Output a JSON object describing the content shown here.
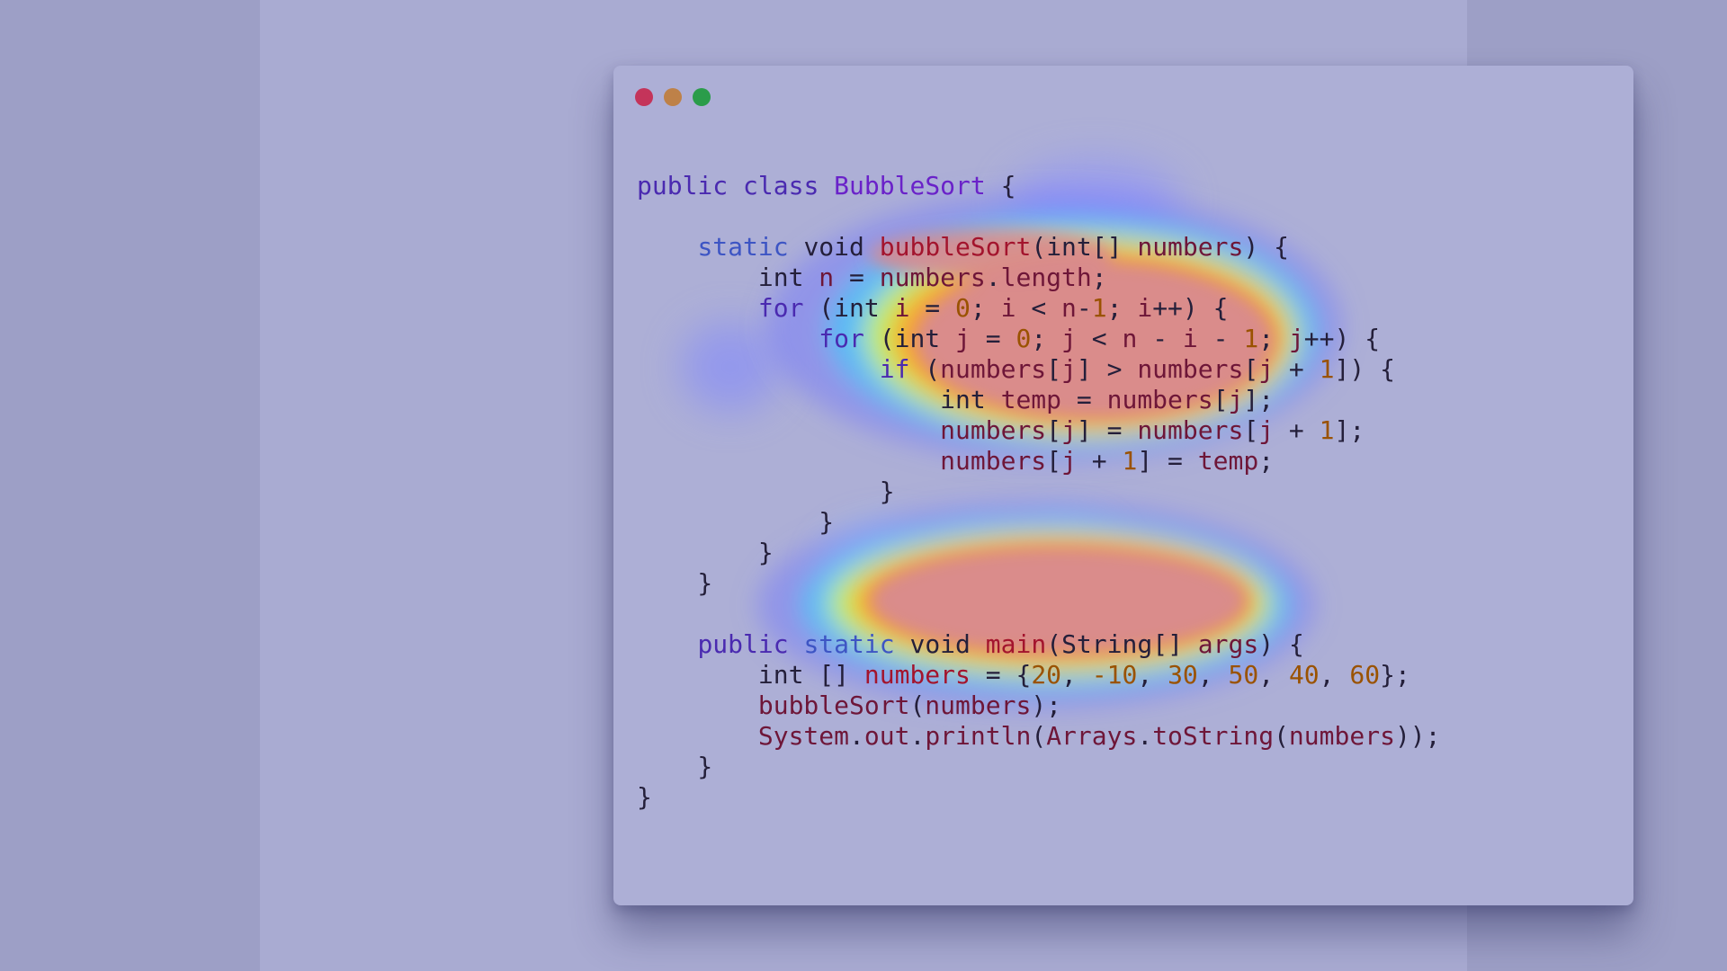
{
  "window_controls": {
    "close": {
      "color": "#c4345a"
    },
    "minimize": {
      "color": "#be8148"
    },
    "maximize": {
      "color": "#2a9c4a"
    }
  },
  "colors": {
    "outer_background": "#9d9fc6",
    "stage_background": "#a9abd2",
    "window_background": "#adafd6"
  },
  "overlay": {
    "type": "attention-heatmap",
    "palette": [
      "blue",
      "cyan",
      "yellow",
      "red"
    ]
  },
  "code": {
    "language": "java",
    "lines": [
      [
        {
          "t": "public ",
          "c": "kw"
        },
        {
          "t": "class ",
          "c": "kw"
        },
        {
          "t": "BubbleSort",
          "c": "cls"
        },
        {
          "t": " {",
          "c": "pl"
        }
      ],
      [],
      [
        {
          "t": "    ",
          "c": "pl"
        },
        {
          "t": "static ",
          "c": "kw2"
        },
        {
          "t": "void ",
          "c": "pl"
        },
        {
          "t": "bubbleSort",
          "c": "fn"
        },
        {
          "t": "(",
          "c": "pl"
        },
        {
          "t": "int",
          "c": "pl"
        },
        {
          "t": "[] ",
          "c": "pl"
        },
        {
          "t": "numbers",
          "c": "id"
        },
        {
          "t": ") {",
          "c": "pl"
        }
      ],
      [
        {
          "t": "        ",
          "c": "pl"
        },
        {
          "t": "int ",
          "c": "pl"
        },
        {
          "t": "n",
          "c": "id"
        },
        {
          "t": " = ",
          "c": "pl"
        },
        {
          "t": "numbers",
          "c": "id"
        },
        {
          "t": ".",
          "c": "pl"
        },
        {
          "t": "length",
          "c": "id"
        },
        {
          "t": ";",
          "c": "pl"
        }
      ],
      [
        {
          "t": "        ",
          "c": "pl"
        },
        {
          "t": "for",
          "c": "kw"
        },
        {
          "t": " (",
          "c": "pl"
        },
        {
          "t": "int ",
          "c": "pl"
        },
        {
          "t": "i",
          "c": "id"
        },
        {
          "t": " = ",
          "c": "pl"
        },
        {
          "t": "0",
          "c": "num"
        },
        {
          "t": "; ",
          "c": "pl"
        },
        {
          "t": "i",
          "c": "id"
        },
        {
          "t": " < ",
          "c": "pl"
        },
        {
          "t": "n",
          "c": "id"
        },
        {
          "t": "-",
          "c": "pl"
        },
        {
          "t": "1",
          "c": "num"
        },
        {
          "t": "; ",
          "c": "pl"
        },
        {
          "t": "i",
          "c": "id"
        },
        {
          "t": "++) {",
          "c": "pl"
        }
      ],
      [
        {
          "t": "            ",
          "c": "pl"
        },
        {
          "t": "for",
          "c": "kw"
        },
        {
          "t": " (",
          "c": "pl"
        },
        {
          "t": "int ",
          "c": "pl"
        },
        {
          "t": "j",
          "c": "id"
        },
        {
          "t": " = ",
          "c": "pl"
        },
        {
          "t": "0",
          "c": "num"
        },
        {
          "t": "; ",
          "c": "pl"
        },
        {
          "t": "j",
          "c": "id"
        },
        {
          "t": " < ",
          "c": "pl"
        },
        {
          "t": "n",
          "c": "id"
        },
        {
          "t": " - ",
          "c": "pl"
        },
        {
          "t": "i",
          "c": "id"
        },
        {
          "t": " - ",
          "c": "pl"
        },
        {
          "t": "1",
          "c": "num"
        },
        {
          "t": "; ",
          "c": "pl"
        },
        {
          "t": "j",
          "c": "id"
        },
        {
          "t": "++) {",
          "c": "pl"
        }
      ],
      [
        {
          "t": "                ",
          "c": "pl"
        },
        {
          "t": "if",
          "c": "kw"
        },
        {
          "t": " (",
          "c": "pl"
        },
        {
          "t": "numbers",
          "c": "id"
        },
        {
          "t": "[",
          "c": "pl"
        },
        {
          "t": "j",
          "c": "id"
        },
        {
          "t": "] > ",
          "c": "pl"
        },
        {
          "t": "numbers",
          "c": "id"
        },
        {
          "t": "[",
          "c": "pl"
        },
        {
          "t": "j",
          "c": "id"
        },
        {
          "t": " + ",
          "c": "pl"
        },
        {
          "t": "1",
          "c": "num"
        },
        {
          "t": "]) {",
          "c": "pl"
        }
      ],
      [
        {
          "t": "                    ",
          "c": "pl"
        },
        {
          "t": "int ",
          "c": "pl"
        },
        {
          "t": "temp",
          "c": "id"
        },
        {
          "t": " = ",
          "c": "pl"
        },
        {
          "t": "numbers",
          "c": "id"
        },
        {
          "t": "[",
          "c": "pl"
        },
        {
          "t": "j",
          "c": "id"
        },
        {
          "t": "];",
          "c": "pl"
        }
      ],
      [
        {
          "t": "                    ",
          "c": "pl"
        },
        {
          "t": "numbers",
          "c": "id"
        },
        {
          "t": "[",
          "c": "pl"
        },
        {
          "t": "j",
          "c": "id"
        },
        {
          "t": "] = ",
          "c": "pl"
        },
        {
          "t": "numbers",
          "c": "id"
        },
        {
          "t": "[",
          "c": "pl"
        },
        {
          "t": "j",
          "c": "id"
        },
        {
          "t": " + ",
          "c": "pl"
        },
        {
          "t": "1",
          "c": "num"
        },
        {
          "t": "];",
          "c": "pl"
        }
      ],
      [
        {
          "t": "                    ",
          "c": "pl"
        },
        {
          "t": "numbers",
          "c": "id"
        },
        {
          "t": "[",
          "c": "pl"
        },
        {
          "t": "j",
          "c": "id"
        },
        {
          "t": " + ",
          "c": "pl"
        },
        {
          "t": "1",
          "c": "num"
        },
        {
          "t": "] = ",
          "c": "pl"
        },
        {
          "t": "temp",
          "c": "id"
        },
        {
          "t": ";",
          "c": "pl"
        }
      ],
      [
        {
          "t": "                }",
          "c": "pl"
        }
      ],
      [
        {
          "t": "            }",
          "c": "pl"
        }
      ],
      [
        {
          "t": "        }",
          "c": "pl"
        }
      ],
      [
        {
          "t": "    }",
          "c": "pl"
        }
      ],
      [],
      [
        {
          "t": "    ",
          "c": "pl"
        },
        {
          "t": "public ",
          "c": "kw"
        },
        {
          "t": "static ",
          "c": "kw2"
        },
        {
          "t": "void ",
          "c": "pl"
        },
        {
          "t": "main",
          "c": "fn"
        },
        {
          "t": "(",
          "c": "pl"
        },
        {
          "t": "String",
          "c": "pl"
        },
        {
          "t": "[] ",
          "c": "pl"
        },
        {
          "t": "args",
          "c": "id"
        },
        {
          "t": ") {",
          "c": "pl"
        }
      ],
      [
        {
          "t": "        ",
          "c": "pl"
        },
        {
          "t": "int ",
          "c": "pl"
        },
        {
          "t": "[] ",
          "c": "pl"
        },
        {
          "t": "numbers",
          "c": "fn"
        },
        {
          "t": " = {",
          "c": "pl"
        },
        {
          "t": "20",
          "c": "num"
        },
        {
          "t": ", ",
          "c": "pl"
        },
        {
          "t": "-10",
          "c": "num"
        },
        {
          "t": ", ",
          "c": "pl"
        },
        {
          "t": "30",
          "c": "num"
        },
        {
          "t": ", ",
          "c": "pl"
        },
        {
          "t": "50",
          "c": "num"
        },
        {
          "t": ", ",
          "c": "pl"
        },
        {
          "t": "40",
          "c": "num"
        },
        {
          "t": ", ",
          "c": "pl"
        },
        {
          "t": "60",
          "c": "num"
        },
        {
          "t": "};",
          "c": "pl"
        }
      ],
      [
        {
          "t": "        ",
          "c": "pl"
        },
        {
          "t": "bubbleSort",
          "c": "id"
        },
        {
          "t": "(",
          "c": "pl"
        },
        {
          "t": "numbers",
          "c": "id"
        },
        {
          "t": ");",
          "c": "pl"
        }
      ],
      [
        {
          "t": "        ",
          "c": "pl"
        },
        {
          "t": "System",
          "c": "id"
        },
        {
          "t": ".",
          "c": "pl"
        },
        {
          "t": "out",
          "c": "id"
        },
        {
          "t": ".",
          "c": "pl"
        },
        {
          "t": "println",
          "c": "id"
        },
        {
          "t": "(",
          "c": "pl"
        },
        {
          "t": "Arrays",
          "c": "id"
        },
        {
          "t": ".",
          "c": "pl"
        },
        {
          "t": "toString",
          "c": "id"
        },
        {
          "t": "(",
          "c": "pl"
        },
        {
          "t": "numbers",
          "c": "id"
        },
        {
          "t": "));",
          "c": "pl"
        }
      ],
      [
        {
          "t": "    }",
          "c": "pl"
        }
      ],
      [
        {
          "t": "}",
          "c": "pl"
        }
      ]
    ]
  }
}
